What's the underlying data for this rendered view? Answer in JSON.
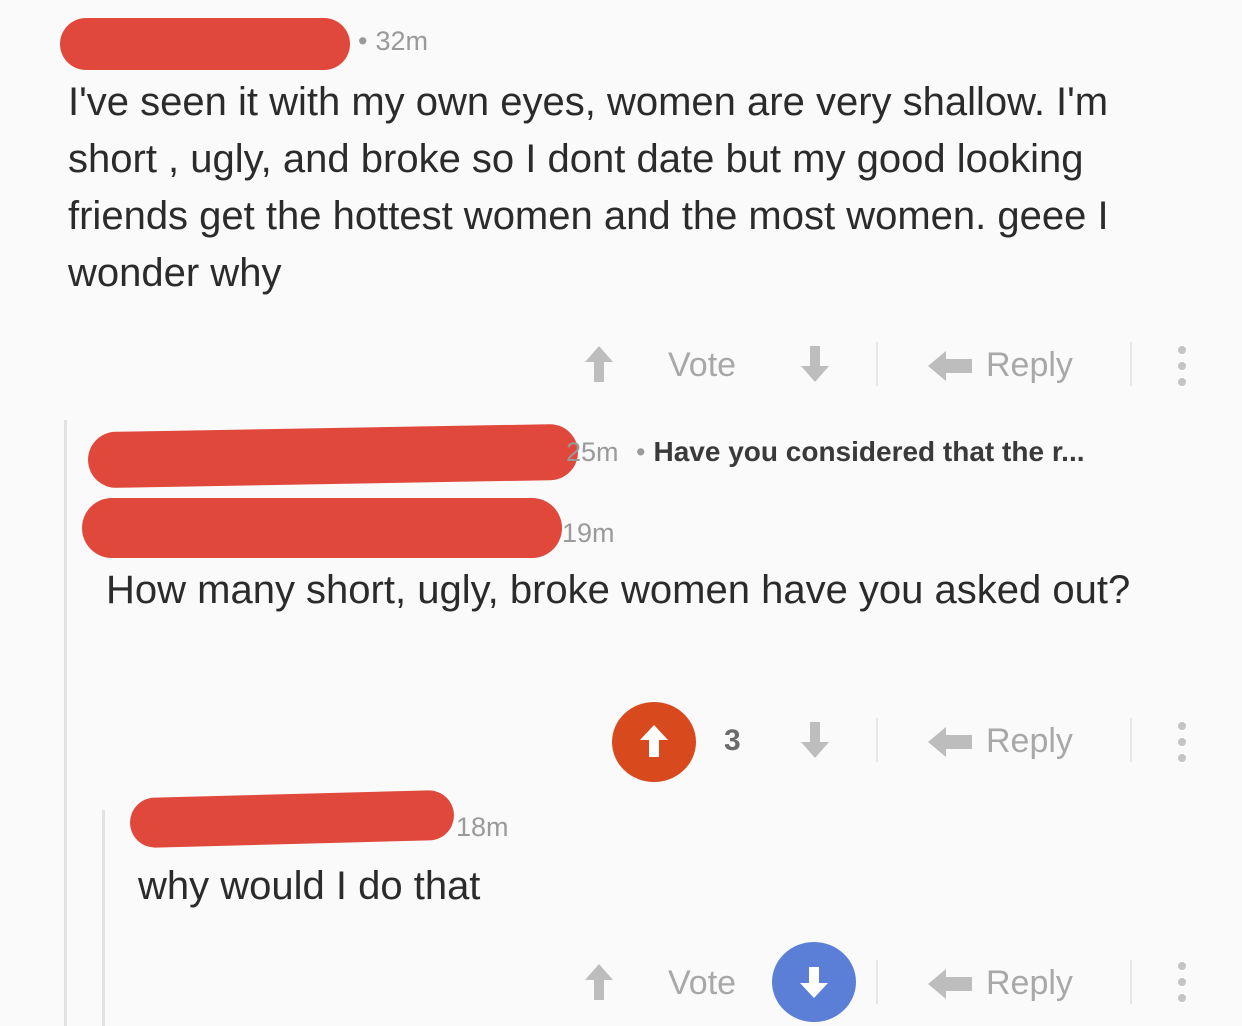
{
  "comments": [
    {
      "time": "32m",
      "text": "I've seen it with my own eyes, women are very shallow. I'm short , ugly, and broke so I dont date but my good looking friends get the hottest women and the most women. geee I wonder why",
      "vote_label": "Vote",
      "reply_label": "Reply"
    },
    {
      "time": "25m",
      "collapsed_snippet": "Have you considered that the r..."
    },
    {
      "time": "19m",
      "text": "How many short, ugly, broke women have you asked out?",
      "score": "3",
      "reply_label": "Reply"
    },
    {
      "time": "18m",
      "text": "why would I do that",
      "vote_label": "Vote",
      "reply_label": "Reply"
    }
  ],
  "colors": {
    "redaction": "#e0483c",
    "upvote_active": "#d84a1e",
    "downvote_active": "#5b7fd6"
  },
  "icons": [
    "upvote-icon",
    "downvote-icon",
    "reply-icon",
    "more-options-icon"
  ]
}
